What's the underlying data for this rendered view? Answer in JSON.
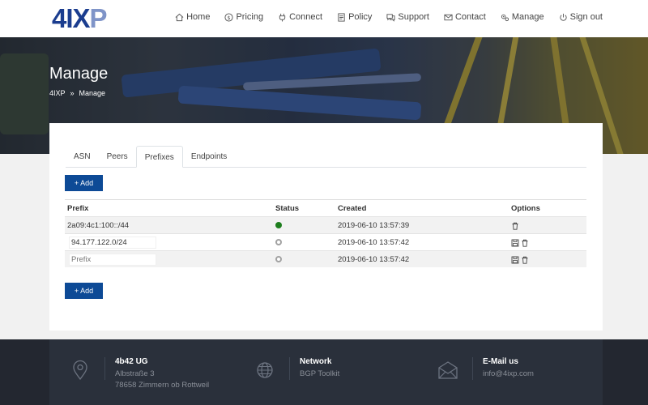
{
  "logo": {
    "part1": "4",
    "part2": "IX",
    "part3": "P"
  },
  "nav": [
    {
      "label": "Home",
      "icon": "home-icon"
    },
    {
      "label": "Pricing",
      "icon": "dollar-icon"
    },
    {
      "label": "Connect",
      "icon": "plug-icon"
    },
    {
      "label": "Policy",
      "icon": "document-icon"
    },
    {
      "label": "Support",
      "icon": "chat-icon"
    },
    {
      "label": "Contact",
      "icon": "mail-icon"
    },
    {
      "label": "Manage",
      "icon": "gears-icon"
    },
    {
      "label": "Sign out",
      "icon": "power-icon"
    }
  ],
  "banner": {
    "title": "Manage",
    "breadcrumb": [
      "4IXP",
      "Manage"
    ]
  },
  "tabs": [
    {
      "label": "ASN",
      "active": false
    },
    {
      "label": "Peers",
      "active": false
    },
    {
      "label": "Prefixes",
      "active": true
    },
    {
      "label": "Endpoints",
      "active": false
    }
  ],
  "add_label": "Add",
  "table": {
    "headers": {
      "prefix": "Prefix",
      "status": "Status",
      "created": "Created",
      "options": "Options"
    },
    "rows": [
      {
        "prefix": "2a09:4c1:100::/44",
        "status": "active",
        "status_color": "#1e7e1e",
        "created": "2019-06-10 13:57:39"
      },
      {
        "prefix_value": "94.177.122.0/24",
        "status": "pending",
        "status_color": "#9a9a9a",
        "created": "2019-06-10 13:57:42"
      },
      {
        "prefix_placeholder": "Prefix",
        "status": "pending",
        "status_color": "#9a9a9a",
        "created": "2019-06-10 13:57:42"
      }
    ]
  },
  "footer": {
    "company": {
      "title": "4b42 UG",
      "line1": "Albstraße 3",
      "line2": "78658 Zimmern ob Rottweil",
      "icon": "location-pin-icon"
    },
    "network": {
      "title": "Network",
      "line1": "BGP Toolkit",
      "icon": "globe-icon"
    },
    "email": {
      "title": "E-Mail us",
      "line1": "info@4ixp.com",
      "icon": "envelope-icon"
    }
  },
  "colors": {
    "brand": "#1b3d8f",
    "button": "#0d4a96",
    "footer": "#2a303b"
  }
}
